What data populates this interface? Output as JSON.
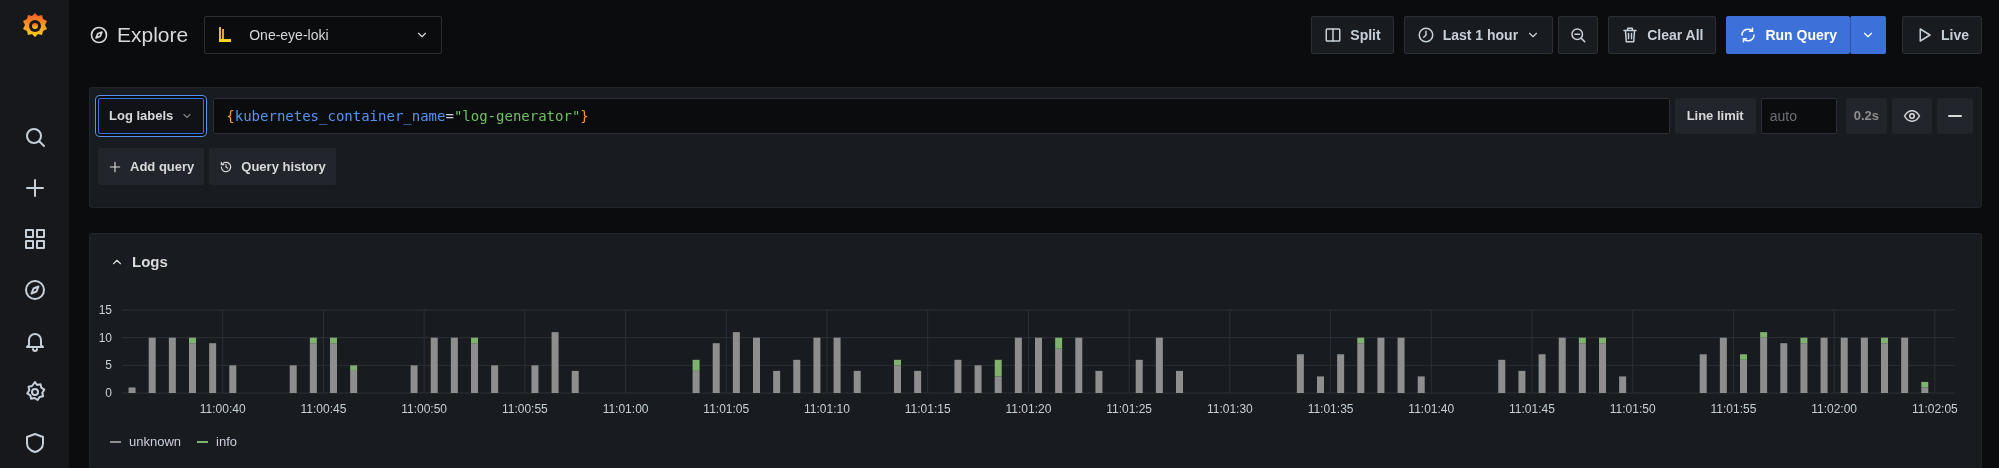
{
  "page": {
    "title": "Explore"
  },
  "datasource": {
    "label": "One-eye-loki"
  },
  "toolbar": {
    "buttons": [
      {
        "kind": "split",
        "label": "Split"
      },
      {
        "kind": "time",
        "label": "Last 1 hour"
      },
      {
        "kind": "zoom"
      },
      {
        "kind": "clear",
        "label": "Clear All"
      },
      {
        "kind": "run",
        "label": "Run Query"
      },
      {
        "kind": "live",
        "label": "Live"
      }
    ]
  },
  "query": {
    "label_button": "Log labels",
    "tokens": [
      {
        "kind": "punctuation",
        "text": "{"
      },
      {
        "kind": "label",
        "text": "kubernetes_container_name"
      },
      {
        "kind": "operator",
        "text": "="
      },
      {
        "kind": "string",
        "text": "\"log-generator\""
      },
      {
        "kind": "punctuation",
        "text": "}"
      }
    ],
    "line_limit_label": "Line limit",
    "line_limit_placeholder": "auto",
    "duration": "0.2s",
    "actions": [
      {
        "kind": "add",
        "label": "Add query"
      },
      {
        "kind": "history",
        "label": "Query history"
      }
    ]
  },
  "logs": {
    "title": "Logs",
    "expanded": true,
    "chart_data": {
      "type": "bar",
      "stacked": true,
      "grid": true,
      "categories": [
        null,
        null,
        null,
        null,
        null,
        "11:00:40",
        null,
        null,
        null,
        null,
        "11:00:45",
        null,
        null,
        null,
        null,
        "11:00:50",
        null,
        null,
        null,
        null,
        "11:00:55",
        null,
        null,
        null,
        null,
        "11:01:00",
        null,
        null,
        null,
        null,
        "11:01:05",
        null,
        null,
        null,
        null,
        "11:01:10",
        null,
        null,
        null,
        null,
        "11:01:15",
        null,
        null,
        null,
        null,
        "11:01:20",
        null,
        null,
        null,
        null,
        "11:01:25",
        null,
        null,
        null,
        null,
        "11:01:30",
        null,
        null,
        null,
        null,
        "11:01:35",
        null,
        null,
        null,
        null,
        "11:01:40",
        null,
        null,
        null,
        null,
        "11:01:45",
        null,
        null,
        null,
        null,
        "11:01:50",
        null,
        null,
        null,
        null,
        "11:01:55",
        null,
        null,
        null,
        null,
        "11:02:00",
        null,
        null,
        null,
        null,
        "11:02:05"
      ],
      "series": [
        {
          "name": "unknown",
          "color": "#8e8e8e",
          "values": [
            1,
            10,
            10,
            9,
            9,
            5,
            0,
            0,
            5,
            9,
            9,
            4,
            0,
            0,
            5,
            10,
            10,
            9,
            5,
            0,
            5,
            11,
            4,
            0,
            0,
            0,
            0,
            0,
            4,
            9,
            11,
            10,
            4,
            6,
            10,
            10,
            4,
            0,
            5,
            4,
            0,
            6,
            5,
            3,
            10,
            10,
            8,
            10,
            4,
            0,
            6,
            10,
            4,
            0,
            0,
            0,
            0,
            0,
            7,
            3,
            7,
            9,
            10,
            10,
            3,
            0,
            0,
            0,
            6,
            4,
            7,
            10,
            9,
            9,
            3,
            0,
            0,
            0,
            7,
            10,
            6,
            10,
            9,
            9,
            10,
            10,
            10,
            9,
            10,
            1,
            0
          ]
        },
        {
          "name": "info",
          "color": "#7eb26d",
          "values": [
            0,
            0,
            0,
            1,
            0,
            0,
            0,
            0,
            0,
            1,
            1,
            1,
            0,
            0,
            0,
            0,
            0,
            1,
            0,
            0,
            0,
            0,
            0,
            0,
            0,
            0,
            0,
            0,
            2,
            0,
            0,
            0,
            0,
            0,
            0,
            0,
            0,
            0,
            1,
            0,
            0,
            0,
            0,
            3,
            0,
            0,
            2,
            0,
            0,
            0,
            0,
            0,
            0,
            0,
            0,
            0,
            0,
            0,
            0,
            0,
            0,
            1,
            0,
            0,
            0,
            0,
            0,
            0,
            0,
            0,
            0,
            0,
            1,
            1,
            0,
            0,
            0,
            0,
            0,
            0,
            1,
            1,
            0,
            1,
            0,
            0,
            0,
            1,
            0,
            1,
            0
          ]
        }
      ],
      "ylim": [
        0,
        15
      ],
      "yticks": [
        0,
        5,
        10,
        15
      ]
    }
  }
}
